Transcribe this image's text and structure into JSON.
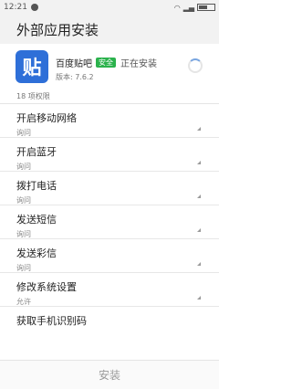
{
  "status_bar": {
    "time": "12:21"
  },
  "header": {
    "title": "外部应用安装"
  },
  "app": {
    "logo_text": "贴",
    "name": "百度贴吧",
    "badge": "安全",
    "status": "正在安装",
    "version": "版本: 7.6.2"
  },
  "permissions": {
    "count_label": "18 项权限",
    "items": [
      {
        "name": "开启移动网络",
        "value": "询问"
      },
      {
        "name": "开启蓝牙",
        "value": "询问"
      },
      {
        "name": "拨打电话",
        "value": "询问"
      },
      {
        "name": "发送短信",
        "value": "询问"
      },
      {
        "name": "发送彩信",
        "value": "询问"
      },
      {
        "name": "修改系统设置",
        "value": "允许"
      },
      {
        "name": "获取手机识别码",
        "value": ""
      }
    ]
  },
  "footer": {
    "install_label": "安装"
  },
  "colors": {
    "brand": "#2e6fd8",
    "safe": "#2bb24c"
  }
}
